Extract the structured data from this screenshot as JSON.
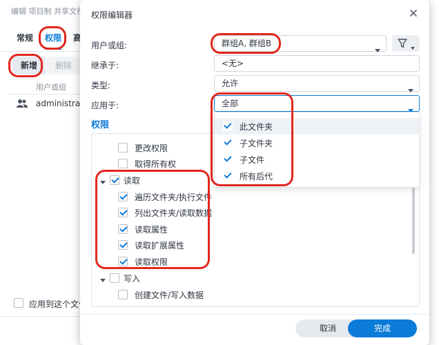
{
  "background": {
    "title": "编辑 项目制 共享文件",
    "tabs": [
      "常规",
      "权限",
      "高"
    ],
    "active_tab": 1,
    "add_button": "新增",
    "delete_button": "删除",
    "column_header": "用户或组",
    "row_user": "administrato",
    "apply_label": "应用到这个文件"
  },
  "dialog": {
    "title": "权限编辑器",
    "fields": {
      "user_label": "用户或组:",
      "user_value": "群组A, 群组B",
      "inherit_label": "继承于:",
      "inherit_value": "<无>",
      "type_label": "类型:",
      "type_value": "允许",
      "apply_label": "应用于:",
      "apply_value": "全部"
    },
    "section_title": "权限",
    "dropdown_items": [
      {
        "label": "此文件夹",
        "checked": true
      },
      {
        "label": "子文件夹",
        "checked": true
      },
      {
        "label": "子文件",
        "checked": true
      },
      {
        "label": "所有后代",
        "checked": true
      }
    ],
    "tree": [
      {
        "label": "更改权限",
        "checked": false,
        "level": 1
      },
      {
        "label": "取得所有权",
        "checked": false,
        "level": 1
      },
      {
        "label": "读取",
        "checked": true,
        "level": 0,
        "expanded": true
      },
      {
        "label": "遍历文件夹/执行文件",
        "checked": true,
        "level": 1
      },
      {
        "label": "列出文件夹/读取数据",
        "checked": true,
        "level": 1
      },
      {
        "label": "读取属性",
        "checked": true,
        "level": 1
      },
      {
        "label": "读取扩展属性",
        "checked": true,
        "level": 1
      },
      {
        "label": "读取权限",
        "checked": true,
        "level": 1
      },
      {
        "label": "写入",
        "checked": false,
        "level": 0,
        "expanded": true
      },
      {
        "label": "创建文件/写入数据",
        "checked": false,
        "level": 1
      }
    ],
    "cancel_button": "取消",
    "ok_button": "完成"
  },
  "colors": {
    "accent": "#0b7bd8",
    "annotation": "#e3261c"
  }
}
